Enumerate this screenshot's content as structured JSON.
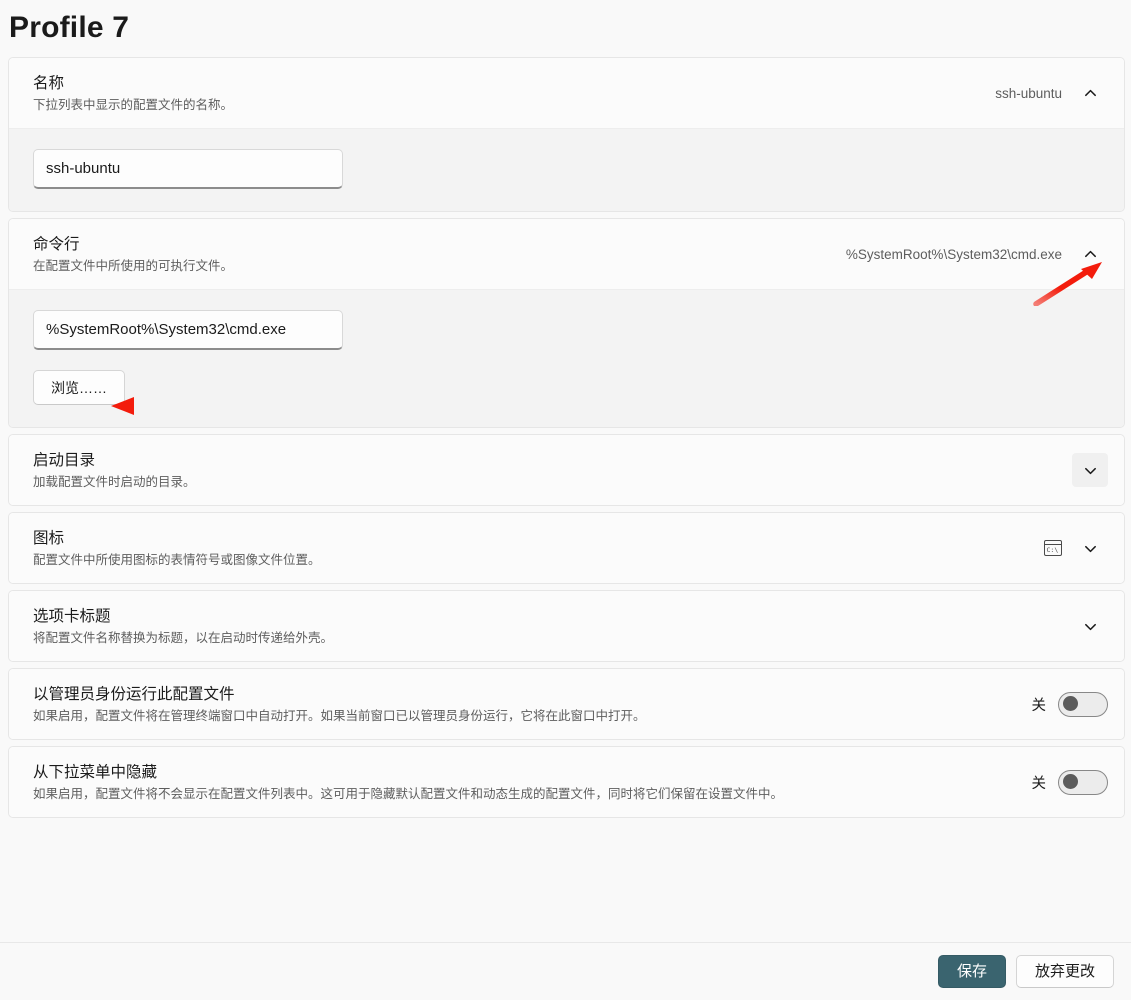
{
  "page": {
    "title": "Profile 7"
  },
  "sections": {
    "name": {
      "title": "名称",
      "desc": "下拉列表中显示的配置文件的名称。",
      "value": "ssh-ubuntu",
      "expanded": true,
      "chevron": "chevron-up",
      "input_value": "ssh-ubuntu"
    },
    "commandline": {
      "title": "命令行",
      "desc": "在配置文件中所使用的可执行文件。",
      "value": "%SystemRoot%\\System32\\cmd.exe",
      "expanded": true,
      "chevron": "chevron-up",
      "input_value": "%SystemRoot%\\System32\\cmd.exe",
      "browse_label": "浏览……"
    },
    "startingdir": {
      "title": "启动目录",
      "desc": "加载配置文件时启动的目录。",
      "value": "",
      "expanded": false,
      "chevron": "chevron-down"
    },
    "icon": {
      "title": "图标",
      "desc": "配置文件中所使用图标的表情符号或图像文件位置。",
      "value": "",
      "expanded": false,
      "chevron": "chevron-down",
      "icon_name": "terminal-icon"
    },
    "tabtitle": {
      "title": "选项卡标题",
      "desc": "将配置文件名称替换为标题，以在启动时传递给外壳。",
      "value": "",
      "expanded": false,
      "chevron": "chevron-down"
    },
    "elevate": {
      "title": "以管理员身份运行此配置文件",
      "desc": "如果启用，配置文件将在管理终端窗口中自动打开。如果当前窗口已以管理员身份运行，它将在此窗口中打开。",
      "toggle_state_label": "关",
      "toggle_on": false
    },
    "hidden": {
      "title": "从下拉菜单中隐藏",
      "desc": "如果启用，配置文件将不会显示在配置文件列表中。这可用于隐藏默认配置文件和动态生成的配置文件，同时将它们保留在设置文件中。",
      "toggle_state_label": "关",
      "toggle_on": false
    }
  },
  "footer": {
    "save_label": "保存",
    "discard_label": "放弃更改"
  },
  "colors": {
    "accent": "#3a646f",
    "annotation": "#f31c0c",
    "page_bg": "#f9f9f9",
    "card_bg": "#fbfbfb",
    "expanded_bg": "#f3f3f3"
  },
  "annotations": [
    {
      "name": "arrow-to-commandline-chevron",
      "kind": "arrow-up-right"
    },
    {
      "name": "arrow-to-browse-button",
      "kind": "arrow-left"
    }
  ]
}
